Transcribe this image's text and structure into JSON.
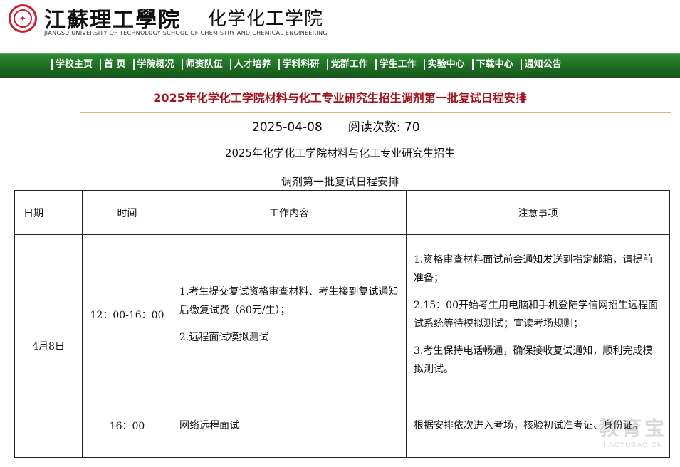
{
  "header": {
    "emblem_icon": "university-seal-icon",
    "university_name": "江蘇理工學院",
    "school_name": "化学化工学院",
    "subtitle_en": "JIANGSU UNIVERSITY OF TECHNOLOGY SCHOOL OF CHEMISTRY AND CHEMICAL ENGINEERING"
  },
  "nav": {
    "items": [
      "学校主页",
      "首 页",
      "学院概况",
      "师资队伍",
      "人才培养",
      "学科科研",
      "党群工作",
      "学生工作",
      "实验中心",
      "下载中心",
      "通知公告"
    ]
  },
  "article": {
    "title": "2025年化学化工学院材料与化工专业研究生招生调剂第一批复试日程安排",
    "date": "2025-04-08",
    "views_label": "阅读次数: 70",
    "heading_line1": "2025年化学化工学院材料与化工专业研究生招生",
    "heading_line2": "调剂第一批复试日程安排"
  },
  "table": {
    "headers": [
      "日期",
      "时间",
      "工作内容",
      "注意事项"
    ],
    "date": "4月8日",
    "rows": [
      {
        "time": "12：00-16：00",
        "content": [
          "1.考生提交复试资格审查材料、考生接到复试通知后缴复试费（80元/生）；",
          "2.远程面试模拟测试"
        ],
        "notes": [
          "1.资格审查材料面试前会通知发送到指定邮箱，请提前准备；",
          "2.15：00开始考生用电脑和手机登陆学信网招生远程面试系统等待模拟测试；宣读考场规则；",
          "3.考生保持电话畅通，确保接收复试通知，顺利完成模拟测试。"
        ]
      },
      {
        "time": "16：00",
        "content": [
          "网络远程面试"
        ],
        "notes": [
          "根据安排依次进入考场，核验初试准考证、身份证。"
        ]
      }
    ]
  },
  "watermark": {
    "cn": "教育宝",
    "en": "JIAOYUBAO.CN"
  },
  "colors": {
    "nav_green": "#1e6b22",
    "title_red": "#a0161e",
    "divider": "#e2b07a"
  }
}
